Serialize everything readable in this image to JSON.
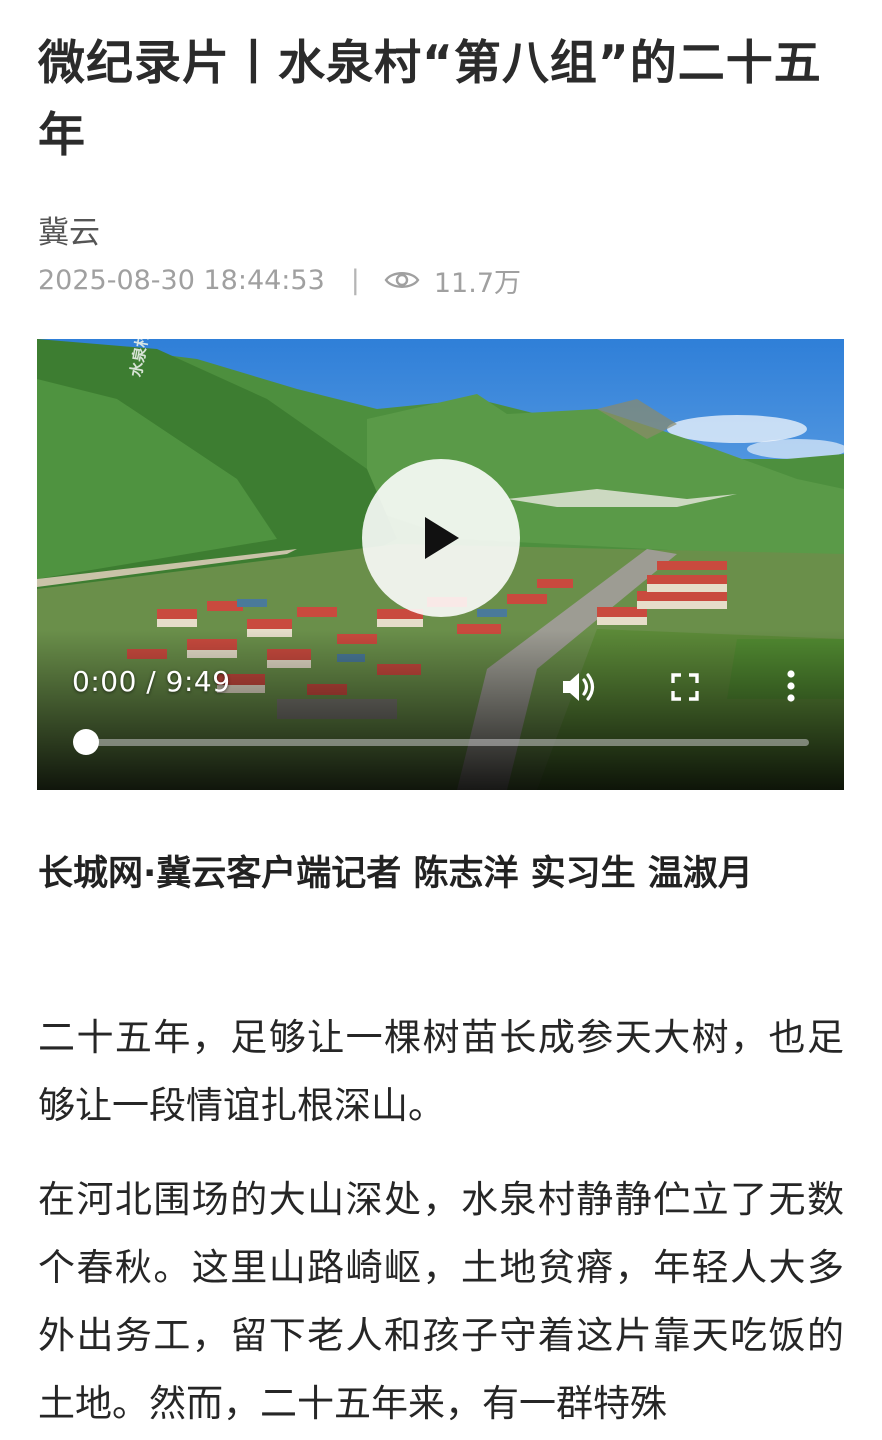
{
  "article": {
    "title": "微纪录片丨水泉村“第八组”的二十五年",
    "source": "冀云",
    "datetime": "2025-08-30 18:44:53",
    "separator": "|",
    "views": "11.7万"
  },
  "video": {
    "sign_text": "水泉村",
    "current_time": "0:00",
    "time_separator": " / ",
    "duration": "9:49",
    "progress": 0,
    "icons": {
      "play": "play-icon",
      "volume": "volume-icon",
      "fullscreen": "fullscreen-icon",
      "more": "more-vertical-icon"
    }
  },
  "body": {
    "byline": "长城网·冀云客户端记者 陈志洋 实习生 温淑月",
    "paragraphs": [
      "二十五年，足够让一棵树苗长成参天大树，也足够让一段情谊扎根深山。",
      "在河北围场的大山深处，水泉村静静伫立了无数个春秋。这里山路崎岖，土地贫瘠，年轻人大多外出务工，留下老人和孩子守着这片靠天吃饭的土地。然而，二十五年来，有一群特殊"
    ]
  },
  "colors": {
    "title": "#2b2b2b",
    "meta": "#a0a0a0",
    "sky": "#3f8fe0",
    "hills": "#3f8a3a"
  }
}
